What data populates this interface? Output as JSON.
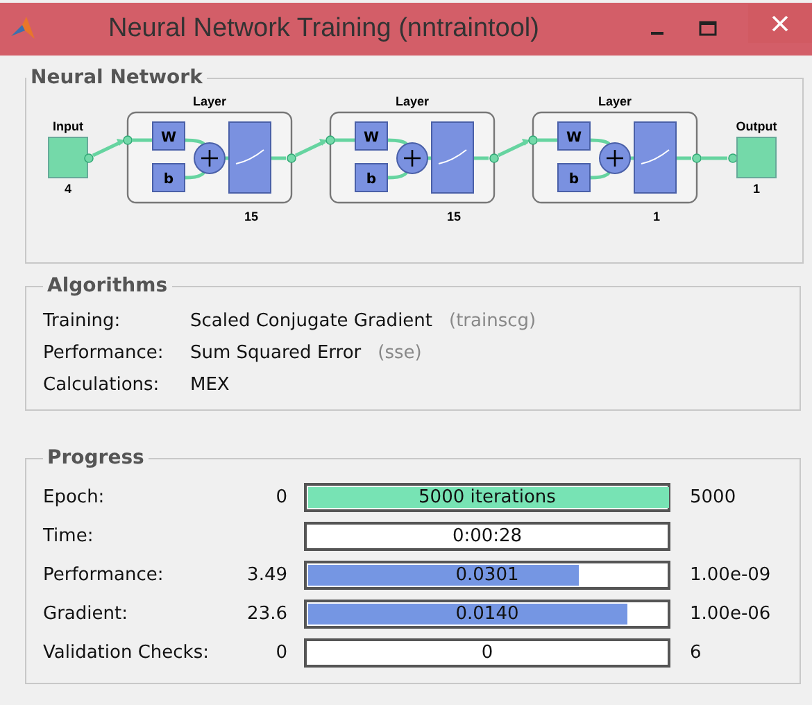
{
  "window": {
    "title": "Neural Network Training (nntraintool)"
  },
  "network": {
    "title": "Neural Network",
    "input": {
      "label": "Input",
      "size": "4"
    },
    "layers": [
      {
        "title": "Layer",
        "weight": "W",
        "bias": "b",
        "size": "15"
      },
      {
        "title": "Layer",
        "weight": "W",
        "bias": "b",
        "size": "15"
      },
      {
        "title": "Layer",
        "weight": "W",
        "bias": "b",
        "size": "1"
      }
    ],
    "output": {
      "label": "Output",
      "size": "1"
    }
  },
  "algorithms": {
    "title": "Algorithms",
    "rows": [
      {
        "label": "Training:",
        "value": "Scaled Conjugate Gradient",
        "code": "(trainscg)"
      },
      {
        "label": "Performance:",
        "value": "Sum Squared Error",
        "code": "(sse)"
      },
      {
        "label": "Calculations:",
        "value": "MEX"
      }
    ]
  },
  "progress": {
    "title": "Progress",
    "rows": [
      {
        "label": "Epoch:",
        "start": "0",
        "reading": "5000 iterations",
        "end": "5000",
        "level": 1,
        "color": "#77e3b4"
      },
      {
        "label": "Time:",
        "reading": "0:00:28"
      },
      {
        "label": "Performance:",
        "start": "3.49",
        "reading": "0.0301",
        "end": "1.00e-09",
        "level": 0.75,
        "color": "#7596e3"
      },
      {
        "label": "Gradient:",
        "start": "23.6",
        "reading": "0.0140",
        "end": "1.00e-06",
        "level": 0.885,
        "color": "#7596e3"
      },
      {
        "label": "Validation Checks:",
        "start": "0",
        "reading": "0",
        "end": "6"
      }
    ]
  }
}
